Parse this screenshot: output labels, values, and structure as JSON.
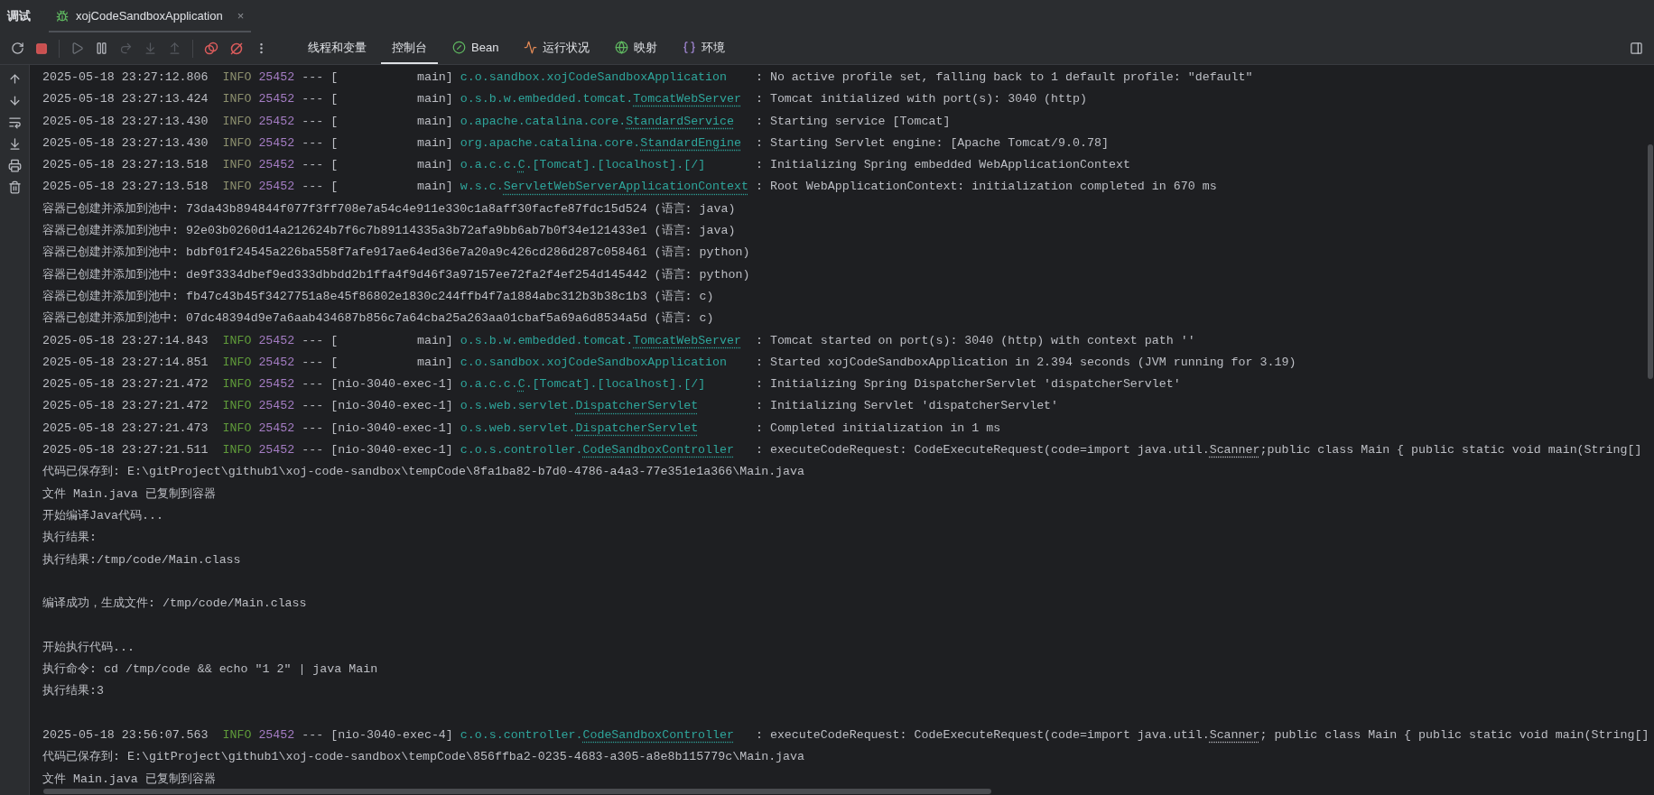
{
  "panel_title": "调试",
  "session_tab": {
    "label": "xojCodeSandboxApplication",
    "close": "×",
    "selected": true
  },
  "toolbar_tabs": [
    {
      "label": "线程和变量",
      "kind": "plain",
      "selected": false
    },
    {
      "label": "控制台",
      "kind": "plain",
      "selected": true
    },
    {
      "label": "Bean",
      "kind": "bean",
      "selected": false
    },
    {
      "label": "运行状况",
      "kind": "health",
      "selected": false
    },
    {
      "label": "映射",
      "kind": "mapping",
      "selected": false
    },
    {
      "label": "环境",
      "kind": "env",
      "selected": false
    }
  ],
  "console": {
    "lines": [
      {
        "kind": "log",
        "time": "2025-05-18 23:27:12.806",
        "level": "INFO",
        "color": "#8c8f6e",
        "pid": "25452",
        "sep": "---",
        "thread": "[           main]",
        "logger_prefix": "c.o.sandbox.xojCodeSandboxApplication",
        "message": ": No active profile set, falling back to 1 default profile: \"default\""
      },
      {
        "kind": "log",
        "time": "2025-05-18 23:27:13.424",
        "level": "INFO",
        "color": "#8c8f6e",
        "pid": "25452",
        "sep": "---",
        "thread": "[           main]",
        "logger_prefix": "o.s.b.w.embedded.tomcat.",
        "logger_link": "TomcatWebServer",
        "message": ": Tomcat initialized with port(s): 3040 (http)"
      },
      {
        "kind": "log",
        "time": "2025-05-18 23:27:13.430",
        "level": "INFO",
        "color": "#8c8f6e",
        "pid": "25452",
        "sep": "---",
        "thread": "[           main]",
        "logger_prefix": "o.apache.catalina.core.",
        "logger_link": "StandardService",
        "message": ": Starting service [Tomcat]"
      },
      {
        "kind": "log",
        "time": "2025-05-18 23:27:13.430",
        "level": "INFO",
        "color": "#8c8f6e",
        "pid": "25452",
        "sep": "---",
        "thread": "[           main]",
        "logger_prefix": "org.apache.catalina.core.",
        "logger_link": "StandardEngine",
        "message": ": Starting Servlet engine: [Apache Tomcat/9.0.78]"
      },
      {
        "kind": "log",
        "time": "2025-05-18 23:27:13.518",
        "level": "INFO",
        "color": "#8c8f6e",
        "pid": "25452",
        "sep": "---",
        "thread": "[           main]",
        "logger_prefix": "o.a.c.c.",
        "logger_link": "C",
        "logger_suffix": ".[Tomcat].[localhost].[/]",
        "message": ": Initializing Spring embedded WebApplicationContext"
      },
      {
        "kind": "log",
        "time": "2025-05-18 23:27:13.518",
        "level": "INFO",
        "color": "#8c8f6e",
        "pid": "25452",
        "sep": "---",
        "thread": "[           main]",
        "logger_prefix": "w.s.c.",
        "logger_link": "ServletWebServerApplicationContext",
        "message": ": Root WebApplicationContext: initialization completed in 670 ms"
      },
      {
        "kind": "text",
        "text": "容器已创建并添加到池中: 73da43b894844f077f3ff708e7a54c4e911e330c1a8aff30facfe87fdc15d524 (语言: java)"
      },
      {
        "kind": "text",
        "text": "容器已创建并添加到池中: 92e03b0260d14a212624b7f6c7b89114335a3b72afa9bb6ab7b0f34e121433e1 (语言: java)"
      },
      {
        "kind": "text",
        "text": "容器已创建并添加到池中: bdbf01f24545a226ba558f7afe917ae64ed36e7a20a9c426cd286d287c058461 (语言: python)"
      },
      {
        "kind": "text",
        "text": "容器已创建并添加到池中: de9f3334dbef9ed333dbbdd2b1ffa4f9d46f3a97157ee72fa2f4ef254d145442 (语言: python)"
      },
      {
        "kind": "text",
        "text": "容器已创建并添加到池中: fb47c43b45f3427751a8e45f86802e1830c244ffb4f7a1884abc312b3b38c1b3 (语言: c)"
      },
      {
        "kind": "text",
        "text": "容器已创建并添加到池中: 07dc48394d9e7a6aab434687b856c7a64cba25a263aa01cbaf5a69a6d8534a5d (语言: c)"
      },
      {
        "kind": "log",
        "time": "2025-05-18 23:27:14.843",
        "level": "INFO",
        "color": "#5f9a3a",
        "pid": "25452",
        "sep": "---",
        "thread": "[           main]",
        "logger_prefix": "o.s.b.w.embedded.tomcat.",
        "logger_link": "TomcatWebServer",
        "message": ": Tomcat started on port(s): 3040 (http) with context path ''"
      },
      {
        "kind": "log",
        "time": "2025-05-18 23:27:14.851",
        "level": "INFO",
        "color": "#5f9a3a",
        "pid": "25452",
        "sep": "---",
        "thread": "[           main]",
        "logger_prefix": "c.o.sandbox.xojCodeSandboxApplication",
        "message": ": Started xojCodeSandboxApplication in 2.394 seconds (JVM running for 3.19)"
      },
      {
        "kind": "log",
        "time": "2025-05-18 23:27:21.472",
        "level": "INFO",
        "color": "#5f9a3a",
        "pid": "25452",
        "sep": "---",
        "thread": "[nio-3040-exec-1]",
        "logger_prefix": "o.a.c.c.",
        "logger_link": "C",
        "logger_suffix": ".[Tomcat].[localhost].[/]",
        "message": ": Initializing Spring DispatcherServlet 'dispatcherServlet'"
      },
      {
        "kind": "log",
        "time": "2025-05-18 23:27:21.472",
        "level": "INFO",
        "color": "#5f9a3a",
        "pid": "25452",
        "sep": "---",
        "thread": "[nio-3040-exec-1]",
        "logger_prefix": "o.s.web.servlet.",
        "logger_link": "DispatcherServlet",
        "message": ": Initializing Servlet 'dispatcherServlet'"
      },
      {
        "kind": "log",
        "time": "2025-05-18 23:27:21.473",
        "level": "INFO",
        "color": "#5f9a3a",
        "pid": "25452",
        "sep": "---",
        "thread": "[nio-3040-exec-1]",
        "logger_prefix": "o.s.web.servlet.",
        "logger_link": "DispatcherServlet",
        "message": ": Completed initialization in 1 ms"
      },
      {
        "kind": "log",
        "time": "2025-05-18 23:27:21.511",
        "level": "INFO",
        "color": "#5f9a3a",
        "pid": "25452",
        "sep": "---",
        "thread": "[nio-3040-exec-1]",
        "logger_prefix": "c.o.s.controller.",
        "logger_link": "CodeSandboxController",
        "message": ": executeCodeRequest: CodeExecuteRequest(code=import java.util.",
        "message_link": "Scanner",
        "message_after": ";public class Main { public static void main(String[]"
      },
      {
        "kind": "text",
        "text": "代码已保存到: E:\\gitProject\\github1\\xoj-code-sandbox\\tempCode\\8fa1ba82-b7d0-4786-a4a3-77e351e1a366\\Main.java"
      },
      {
        "kind": "text",
        "text": "文件 Main.java 已复制到容器"
      },
      {
        "kind": "text",
        "text": "开始编译Java代码..."
      },
      {
        "kind": "text",
        "text": "执行结果:"
      },
      {
        "kind": "text",
        "text": "执行结果:/tmp/code/Main.class"
      },
      {
        "kind": "blank"
      },
      {
        "kind": "text",
        "text": "编译成功，生成文件: /tmp/code/Main.class"
      },
      {
        "kind": "blank"
      },
      {
        "kind": "text",
        "text": "开始执行代码..."
      },
      {
        "kind": "text",
        "text": "执行命令: cd /tmp/code && echo \"1 2\" | java Main"
      },
      {
        "kind": "text",
        "text": "执行结果:3"
      },
      {
        "kind": "blank"
      },
      {
        "kind": "log",
        "time": "2025-05-18 23:56:07.563",
        "level": "INFO",
        "color": "#5f9a3a",
        "pid": "25452",
        "sep": "---",
        "thread": "[nio-3040-exec-4]",
        "logger_prefix": "c.o.s.controller.",
        "logger_link": "CodeSandboxController",
        "message": ": executeCodeRequest: CodeExecuteRequest(code=import java.util.",
        "message_link": "Scanner",
        "message_after": "; public class Main { public static void main(String[]"
      },
      {
        "kind": "text",
        "text": "代码已保存到: E:\\gitProject\\github1\\xoj-code-sandbox\\tempCode\\856ffba2-0235-4683-a305-a8e8b115779c\\Main.java"
      },
      {
        "kind": "text",
        "text": "文件 Main.java 已复制到容器"
      }
    ]
  }
}
